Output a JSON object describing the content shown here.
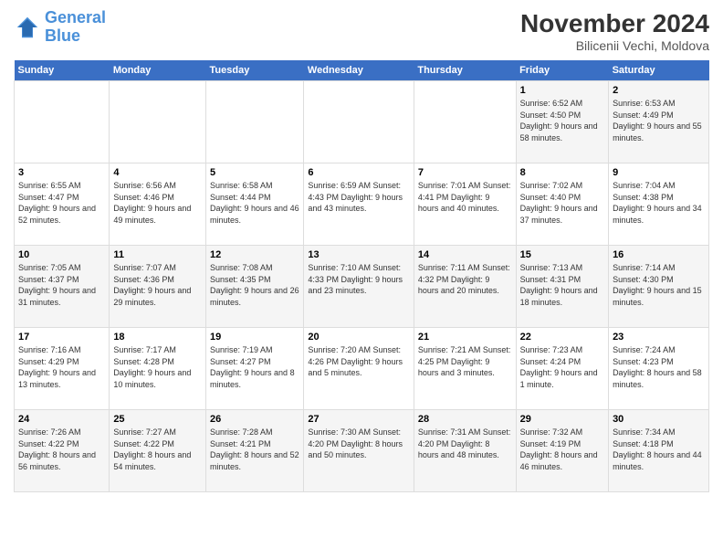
{
  "header": {
    "logo_line1": "General",
    "logo_line2": "Blue",
    "title": "November 2024",
    "subtitle": "Bilicenii Vechi, Moldova"
  },
  "weekdays": [
    "Sunday",
    "Monday",
    "Tuesday",
    "Wednesday",
    "Thursday",
    "Friday",
    "Saturday"
  ],
  "weeks": [
    [
      {
        "day": "",
        "info": ""
      },
      {
        "day": "",
        "info": ""
      },
      {
        "day": "",
        "info": ""
      },
      {
        "day": "",
        "info": ""
      },
      {
        "day": "",
        "info": ""
      },
      {
        "day": "1",
        "info": "Sunrise: 6:52 AM\nSunset: 4:50 PM\nDaylight: 9 hours and 58 minutes."
      },
      {
        "day": "2",
        "info": "Sunrise: 6:53 AM\nSunset: 4:49 PM\nDaylight: 9 hours and 55 minutes."
      }
    ],
    [
      {
        "day": "3",
        "info": "Sunrise: 6:55 AM\nSunset: 4:47 PM\nDaylight: 9 hours and 52 minutes."
      },
      {
        "day": "4",
        "info": "Sunrise: 6:56 AM\nSunset: 4:46 PM\nDaylight: 9 hours and 49 minutes."
      },
      {
        "day": "5",
        "info": "Sunrise: 6:58 AM\nSunset: 4:44 PM\nDaylight: 9 hours and 46 minutes."
      },
      {
        "day": "6",
        "info": "Sunrise: 6:59 AM\nSunset: 4:43 PM\nDaylight: 9 hours and 43 minutes."
      },
      {
        "day": "7",
        "info": "Sunrise: 7:01 AM\nSunset: 4:41 PM\nDaylight: 9 hours and 40 minutes."
      },
      {
        "day": "8",
        "info": "Sunrise: 7:02 AM\nSunset: 4:40 PM\nDaylight: 9 hours and 37 minutes."
      },
      {
        "day": "9",
        "info": "Sunrise: 7:04 AM\nSunset: 4:38 PM\nDaylight: 9 hours and 34 minutes."
      }
    ],
    [
      {
        "day": "10",
        "info": "Sunrise: 7:05 AM\nSunset: 4:37 PM\nDaylight: 9 hours and 31 minutes."
      },
      {
        "day": "11",
        "info": "Sunrise: 7:07 AM\nSunset: 4:36 PM\nDaylight: 9 hours and 29 minutes."
      },
      {
        "day": "12",
        "info": "Sunrise: 7:08 AM\nSunset: 4:35 PM\nDaylight: 9 hours and 26 minutes."
      },
      {
        "day": "13",
        "info": "Sunrise: 7:10 AM\nSunset: 4:33 PM\nDaylight: 9 hours and 23 minutes."
      },
      {
        "day": "14",
        "info": "Sunrise: 7:11 AM\nSunset: 4:32 PM\nDaylight: 9 hours and 20 minutes."
      },
      {
        "day": "15",
        "info": "Sunrise: 7:13 AM\nSunset: 4:31 PM\nDaylight: 9 hours and 18 minutes."
      },
      {
        "day": "16",
        "info": "Sunrise: 7:14 AM\nSunset: 4:30 PM\nDaylight: 9 hours and 15 minutes."
      }
    ],
    [
      {
        "day": "17",
        "info": "Sunrise: 7:16 AM\nSunset: 4:29 PM\nDaylight: 9 hours and 13 minutes."
      },
      {
        "day": "18",
        "info": "Sunrise: 7:17 AM\nSunset: 4:28 PM\nDaylight: 9 hours and 10 minutes."
      },
      {
        "day": "19",
        "info": "Sunrise: 7:19 AM\nSunset: 4:27 PM\nDaylight: 9 hours and 8 minutes."
      },
      {
        "day": "20",
        "info": "Sunrise: 7:20 AM\nSunset: 4:26 PM\nDaylight: 9 hours and 5 minutes."
      },
      {
        "day": "21",
        "info": "Sunrise: 7:21 AM\nSunset: 4:25 PM\nDaylight: 9 hours and 3 minutes."
      },
      {
        "day": "22",
        "info": "Sunrise: 7:23 AM\nSunset: 4:24 PM\nDaylight: 9 hours and 1 minute."
      },
      {
        "day": "23",
        "info": "Sunrise: 7:24 AM\nSunset: 4:23 PM\nDaylight: 8 hours and 58 minutes."
      }
    ],
    [
      {
        "day": "24",
        "info": "Sunrise: 7:26 AM\nSunset: 4:22 PM\nDaylight: 8 hours and 56 minutes."
      },
      {
        "day": "25",
        "info": "Sunrise: 7:27 AM\nSunset: 4:22 PM\nDaylight: 8 hours and 54 minutes."
      },
      {
        "day": "26",
        "info": "Sunrise: 7:28 AM\nSunset: 4:21 PM\nDaylight: 8 hours and 52 minutes."
      },
      {
        "day": "27",
        "info": "Sunrise: 7:30 AM\nSunset: 4:20 PM\nDaylight: 8 hours and 50 minutes."
      },
      {
        "day": "28",
        "info": "Sunrise: 7:31 AM\nSunset: 4:20 PM\nDaylight: 8 hours and 48 minutes."
      },
      {
        "day": "29",
        "info": "Sunrise: 7:32 AM\nSunset: 4:19 PM\nDaylight: 8 hours and 46 minutes."
      },
      {
        "day": "30",
        "info": "Sunrise: 7:34 AM\nSunset: 4:18 PM\nDaylight: 8 hours and 44 minutes."
      }
    ]
  ]
}
